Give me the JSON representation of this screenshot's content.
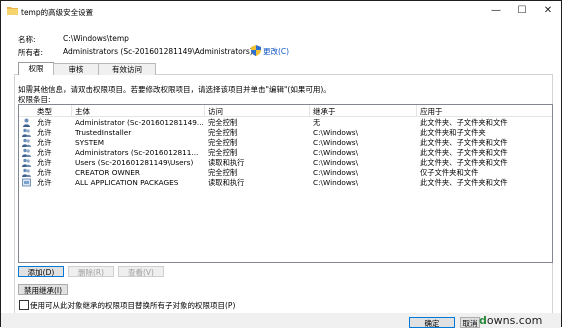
{
  "window": {
    "title": "temp的高级安全设置",
    "controls": {
      "minimize": "—",
      "maximize": "☐",
      "close": "✕"
    }
  },
  "info": {
    "name_label": "名称:",
    "name_value": "C:\\Windows\\temp",
    "owner_label": "所有者:",
    "owner_value": "Administrators (Sc-201601281149\\Administrators)",
    "change_link": "更改(C)"
  },
  "tabs": [
    {
      "label": "权限",
      "active": true
    },
    {
      "label": "审核",
      "active": false
    },
    {
      "label": "有效访问",
      "active": false
    }
  ],
  "instructions": "如需其他信息，请双击权限项目。若要修改权限项目，请选择该项目并单击\"编辑\"(如果可用)。",
  "list_title": "权限条目:",
  "columns": [
    "类型",
    "主体",
    "访问",
    "继承于",
    "应用于"
  ],
  "rows": [
    {
      "icon": "user-icon",
      "type": "允许",
      "principal": "Administrator (Sc-201601281149...",
      "access": "完全控制",
      "inherited": "无",
      "applies": "此文件夹、子文件夹和文件"
    },
    {
      "icon": "group-icon",
      "type": "允许",
      "principal": "TrustedInstaller",
      "access": "完全控制",
      "inherited": "C:\\Windows\\",
      "applies": "此文件夹和子文件夹"
    },
    {
      "icon": "group-icon",
      "type": "允许",
      "principal": "SYSTEM",
      "access": "完全控制",
      "inherited": "C:\\Windows\\",
      "applies": "此文件夹、子文件夹和文件"
    },
    {
      "icon": "group-icon",
      "type": "允许",
      "principal": "Administrators (Sc-2016012811...",
      "access": "完全控制",
      "inherited": "C:\\Windows\\",
      "applies": "此文件夹、子文件夹和文件"
    },
    {
      "icon": "group-icon",
      "type": "允许",
      "principal": "Users (Sc-201601281149\\Users)",
      "access": "读取和执行",
      "inherited": "C:\\Windows\\",
      "applies": "此文件夹、子文件夹和文件"
    },
    {
      "icon": "group-icon",
      "type": "允许",
      "principal": "CREATOR OWNER",
      "access": "完全控制",
      "inherited": "C:\\Windows\\",
      "applies": "仅子文件夹和文件"
    },
    {
      "icon": "package-icon",
      "type": "允许",
      "principal": "ALL APPLICATION PACKAGES",
      "access": "读取和执行",
      "inherited": "C:\\Windows\\",
      "applies": "此文件夹、子文件夹和文件"
    }
  ],
  "buttons": {
    "add": "添加(D)",
    "remove": "删除(R)",
    "view": "查看(V)",
    "disable_inheritance": "禁用继承(I)",
    "ok": "确定",
    "cancel": "取消"
  },
  "checkbox_label": "使用可从此对象继承的权限项目替换所有子对象的权限项目(P)",
  "watermark": "downs.com"
}
